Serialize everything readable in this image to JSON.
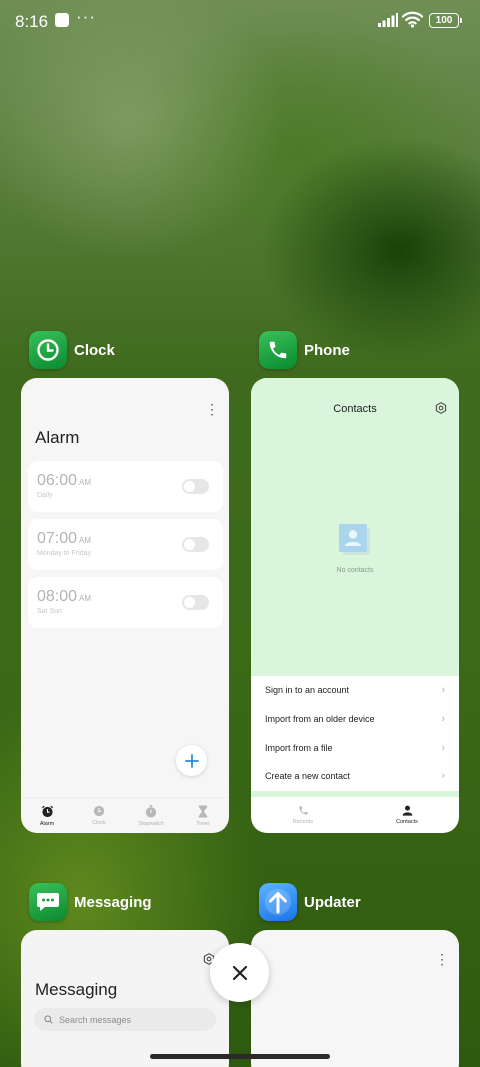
{
  "status_bar": {
    "time": "8:16",
    "notification_icons": [
      "square-icon",
      "dots-icon"
    ],
    "indicators": [
      "signal-icon",
      "wifi-icon",
      "battery-icon"
    ],
    "battery": "100"
  },
  "recent_apps": {
    "clock": {
      "name": "Clock",
      "icon": "clock-icon",
      "title": "Alarm",
      "alarms": [
        {
          "time": "06:00",
          "ampm": "AM",
          "label": "Daily",
          "enabled": false
        },
        {
          "time": "07:00",
          "ampm": "AM",
          "label": "Monday to Friday",
          "enabled": false
        },
        {
          "time": "08:00",
          "ampm": "AM",
          "label": "Sat Sun",
          "enabled": false
        }
      ],
      "tabs": [
        {
          "label": "Alarm",
          "icon": "alarm-icon",
          "active": true
        },
        {
          "label": "Clock",
          "icon": "clock-icon",
          "active": false
        },
        {
          "label": "Stopwatch",
          "icon": "stopwatch-icon",
          "active": false
        },
        {
          "label": "Timer",
          "icon": "hourglass-icon",
          "active": false
        }
      ]
    },
    "phone": {
      "name": "Phone",
      "icon": "phone-icon",
      "title": "Contacts",
      "empty_text": "No contacts",
      "menu": [
        "Sign in to an account",
        "Import from an older device",
        "Import from a file",
        "Create a new contact"
      ],
      "tabs": [
        {
          "label": "Recents",
          "icon": "phone-icon",
          "active": false
        },
        {
          "label": "Contacts",
          "icon": "person-icon",
          "active": true
        }
      ]
    },
    "messaging": {
      "name": "Messaging",
      "icon": "chat-icon",
      "title": "Messaging",
      "search_placeholder": "Search messages"
    },
    "updater": {
      "name": "Updater",
      "icon": "arrow-up-icon"
    }
  },
  "colors": {
    "app_icon_green": "#0a8a2f",
    "app_icon_blue": "#1a73e8",
    "contacts_bg": "#d9f5dc",
    "fab_plus": "#2a8be0"
  }
}
